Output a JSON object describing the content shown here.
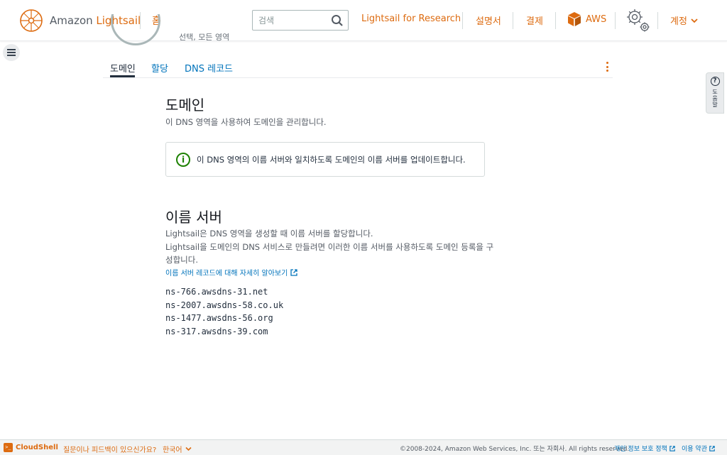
{
  "header": {
    "logo_prefix": "Amazon",
    "logo_brand": "Lightsail",
    "home_label": "홈",
    "search_placeholder": "검색",
    "research_label": "Lightsail for Research",
    "docs_label": "설명서",
    "billing_label": "결제",
    "aws_label": "AWS",
    "account_label": "계정"
  },
  "zone_subtitle_remnant": "선택, 모든 영역",
  "tabs": [
    {
      "label": "도메인",
      "active": true
    },
    {
      "label": "할당",
      "active": false
    },
    {
      "label": "DNS 레코드",
      "active": false
    }
  ],
  "help_tab": {
    "label": "도움말"
  },
  "domains": {
    "title": "도메인",
    "description": "이 DNS 영역을 사용하여 도메인을 관리합니다.",
    "alert": "이 DNS 영역의 이름 서버와 일치하도록 도메인의 이름 서버를 업데이트합니다."
  },
  "name_servers": {
    "title": "이름 서버",
    "line1": "Lightsail은 DNS 영역을 생성할 때 이름 서버를 할당합니다.",
    "line2": "Lightsail을 도메인의 DNS 서비스로 만들려면 이러한 이름 서버를 사용하도록 도메인 등록을 구",
    "line3": "성합니다.",
    "learn_more": "이름 서버 레코드에 대해 자세히 알아보기",
    "servers": [
      "ns-766.awsdns-31.net",
      "ns-2007.awsdns-58.co.uk",
      "ns-1477.awsdns-56.org",
      "ns-317.awsdns-39.com"
    ]
  },
  "footer": {
    "cloudshell": "CloudShell",
    "feedback": "질문이나 피드백이 있으신가요?",
    "language": "한국어",
    "copyright": "©2008-2024, Amazon Web Services, Inc. 또는 자회사. All rights reserved.",
    "privacy": "개인 정보 보호 정책",
    "terms": "이용 약관"
  },
  "colors": {
    "accent": "#dd6b10",
    "link": "#0073bb",
    "success": "#1d8102"
  }
}
